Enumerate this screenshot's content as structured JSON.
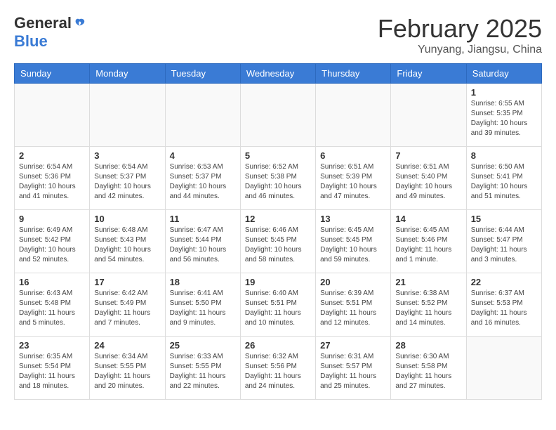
{
  "header": {
    "logo": {
      "general": "General",
      "blue": "Blue"
    },
    "title": "February 2025",
    "subtitle": "Yunyang, Jiangsu, China"
  },
  "weekdays": [
    "Sunday",
    "Monday",
    "Tuesday",
    "Wednesday",
    "Thursday",
    "Friday",
    "Saturday"
  ],
  "weeks": [
    [
      {
        "day": "",
        "info": ""
      },
      {
        "day": "",
        "info": ""
      },
      {
        "day": "",
        "info": ""
      },
      {
        "day": "",
        "info": ""
      },
      {
        "day": "",
        "info": ""
      },
      {
        "day": "",
        "info": ""
      },
      {
        "day": "1",
        "info": "Sunrise: 6:55 AM\nSunset: 5:35 PM\nDaylight: 10 hours and 39 minutes."
      }
    ],
    [
      {
        "day": "2",
        "info": "Sunrise: 6:54 AM\nSunset: 5:36 PM\nDaylight: 10 hours and 41 minutes."
      },
      {
        "day": "3",
        "info": "Sunrise: 6:54 AM\nSunset: 5:37 PM\nDaylight: 10 hours and 42 minutes."
      },
      {
        "day": "4",
        "info": "Sunrise: 6:53 AM\nSunset: 5:37 PM\nDaylight: 10 hours and 44 minutes."
      },
      {
        "day": "5",
        "info": "Sunrise: 6:52 AM\nSunset: 5:38 PM\nDaylight: 10 hours and 46 minutes."
      },
      {
        "day": "6",
        "info": "Sunrise: 6:51 AM\nSunset: 5:39 PM\nDaylight: 10 hours and 47 minutes."
      },
      {
        "day": "7",
        "info": "Sunrise: 6:51 AM\nSunset: 5:40 PM\nDaylight: 10 hours and 49 minutes."
      },
      {
        "day": "8",
        "info": "Sunrise: 6:50 AM\nSunset: 5:41 PM\nDaylight: 10 hours and 51 minutes."
      }
    ],
    [
      {
        "day": "9",
        "info": "Sunrise: 6:49 AM\nSunset: 5:42 PM\nDaylight: 10 hours and 52 minutes."
      },
      {
        "day": "10",
        "info": "Sunrise: 6:48 AM\nSunset: 5:43 PM\nDaylight: 10 hours and 54 minutes."
      },
      {
        "day": "11",
        "info": "Sunrise: 6:47 AM\nSunset: 5:44 PM\nDaylight: 10 hours and 56 minutes."
      },
      {
        "day": "12",
        "info": "Sunrise: 6:46 AM\nSunset: 5:45 PM\nDaylight: 10 hours and 58 minutes."
      },
      {
        "day": "13",
        "info": "Sunrise: 6:45 AM\nSunset: 5:45 PM\nDaylight: 10 hours and 59 minutes."
      },
      {
        "day": "14",
        "info": "Sunrise: 6:45 AM\nSunset: 5:46 PM\nDaylight: 11 hours and 1 minute."
      },
      {
        "day": "15",
        "info": "Sunrise: 6:44 AM\nSunset: 5:47 PM\nDaylight: 11 hours and 3 minutes."
      }
    ],
    [
      {
        "day": "16",
        "info": "Sunrise: 6:43 AM\nSunset: 5:48 PM\nDaylight: 11 hours and 5 minutes."
      },
      {
        "day": "17",
        "info": "Sunrise: 6:42 AM\nSunset: 5:49 PM\nDaylight: 11 hours and 7 minutes."
      },
      {
        "day": "18",
        "info": "Sunrise: 6:41 AM\nSunset: 5:50 PM\nDaylight: 11 hours and 9 minutes."
      },
      {
        "day": "19",
        "info": "Sunrise: 6:40 AM\nSunset: 5:51 PM\nDaylight: 11 hours and 10 minutes."
      },
      {
        "day": "20",
        "info": "Sunrise: 6:39 AM\nSunset: 5:51 PM\nDaylight: 11 hours and 12 minutes."
      },
      {
        "day": "21",
        "info": "Sunrise: 6:38 AM\nSunset: 5:52 PM\nDaylight: 11 hours and 14 minutes."
      },
      {
        "day": "22",
        "info": "Sunrise: 6:37 AM\nSunset: 5:53 PM\nDaylight: 11 hours and 16 minutes."
      }
    ],
    [
      {
        "day": "23",
        "info": "Sunrise: 6:35 AM\nSunset: 5:54 PM\nDaylight: 11 hours and 18 minutes."
      },
      {
        "day": "24",
        "info": "Sunrise: 6:34 AM\nSunset: 5:55 PM\nDaylight: 11 hours and 20 minutes."
      },
      {
        "day": "25",
        "info": "Sunrise: 6:33 AM\nSunset: 5:55 PM\nDaylight: 11 hours and 22 minutes."
      },
      {
        "day": "26",
        "info": "Sunrise: 6:32 AM\nSunset: 5:56 PM\nDaylight: 11 hours and 24 minutes."
      },
      {
        "day": "27",
        "info": "Sunrise: 6:31 AM\nSunset: 5:57 PM\nDaylight: 11 hours and 25 minutes."
      },
      {
        "day": "28",
        "info": "Sunrise: 6:30 AM\nSunset: 5:58 PM\nDaylight: 11 hours and 27 minutes."
      },
      {
        "day": "",
        "info": ""
      }
    ]
  ]
}
